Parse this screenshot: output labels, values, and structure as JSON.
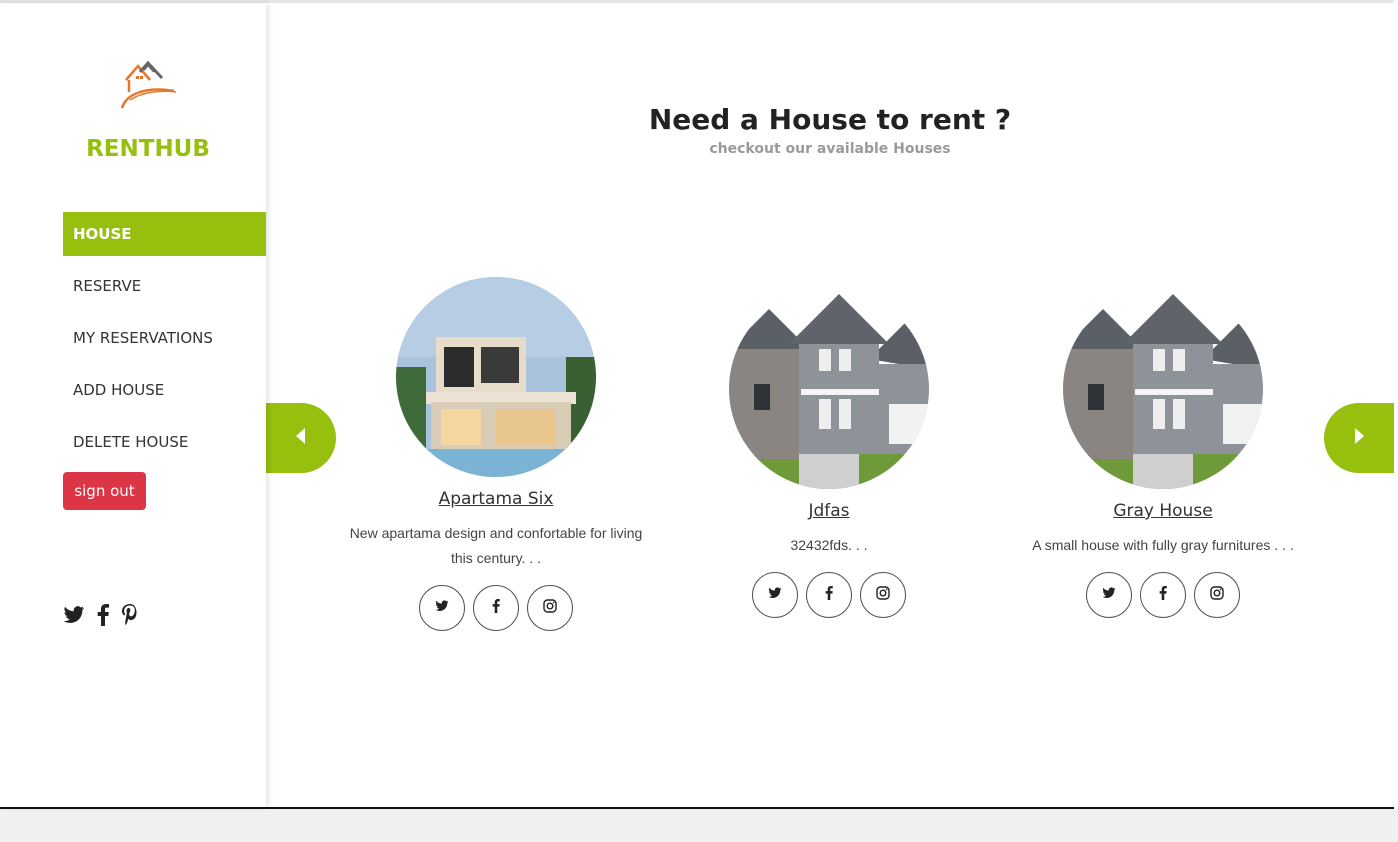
{
  "sidebar": {
    "brand": "RENTHUB",
    "nav": [
      {
        "label": "HOUSE",
        "active": true
      },
      {
        "label": "RESERVE",
        "active": false
      },
      {
        "label": "MY RESERVATIONS",
        "active": false
      },
      {
        "label": "ADD HOUSE",
        "active": false
      },
      {
        "label": "DELETE HOUSE",
        "active": false
      }
    ],
    "signout_label": "sign out",
    "social_icons": [
      "twitter-icon",
      "facebook-icon",
      "pinterest-icon"
    ]
  },
  "main": {
    "title": "Need a House to rent ?",
    "subtitle": "checkout our available Houses",
    "houses": [
      {
        "name": "Apartama Six",
        "description": "New apartama design and confortable for living this century. . ."
      },
      {
        "name": "Jdfas",
        "description": "32432fds. . ."
      },
      {
        "name": "Gray House",
        "description": "A small house with fully gray furnitures . . ."
      }
    ],
    "card_social_icons": [
      "twitter-icon",
      "facebook-icon",
      "instagram-icon"
    ]
  },
  "colors": {
    "accent": "#97c00e",
    "danger": "#dc3545",
    "text": "#222222",
    "muted": "#9a9a9a"
  }
}
